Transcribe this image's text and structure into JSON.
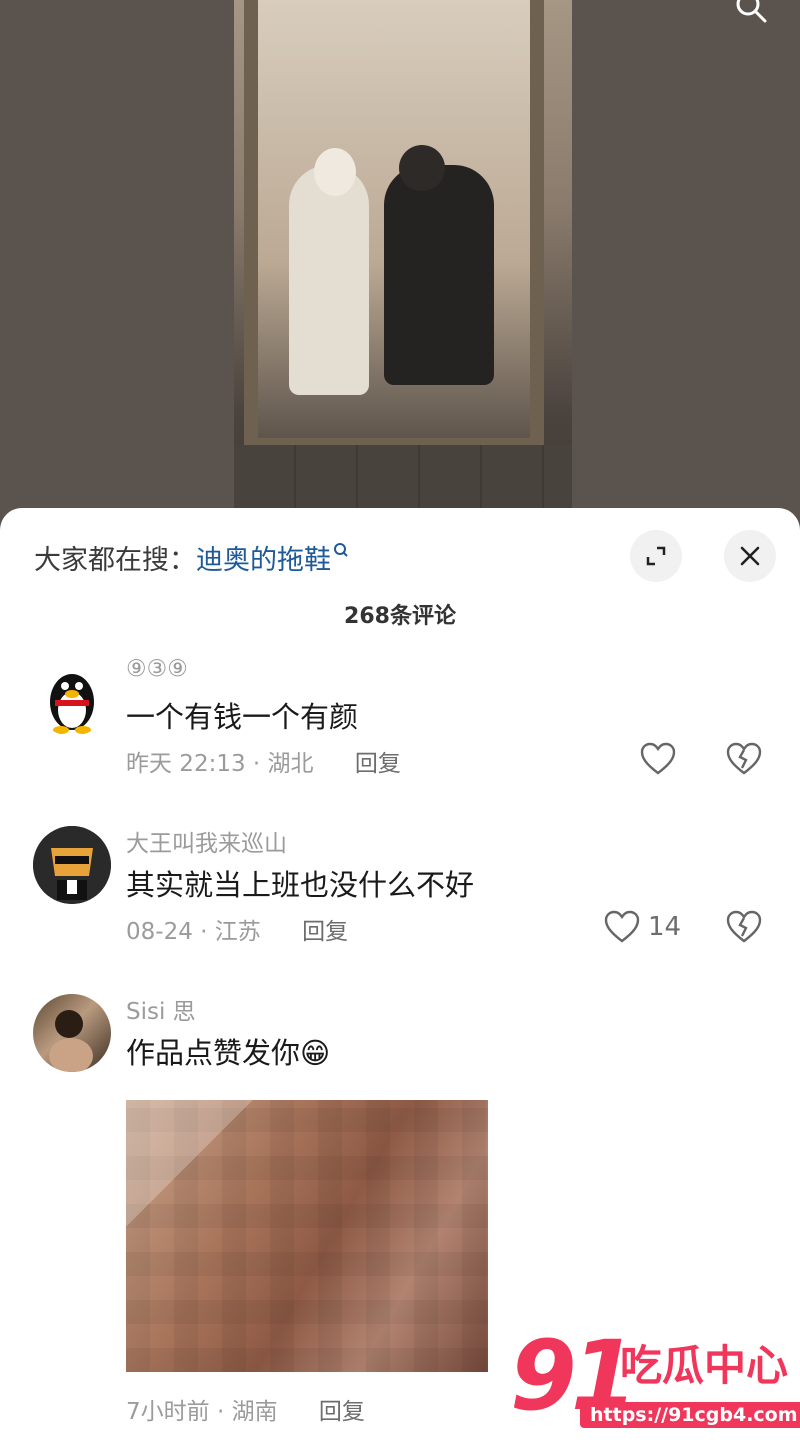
{
  "header": {
    "search_prefix": "大家都在搜：",
    "search_term": "迪奥的拖鞋"
  },
  "comments_count": "268条评论",
  "comments": [
    {
      "username": "⑨③⑨",
      "text": "一个有钱一个有颜",
      "time": "昨天 22:13",
      "location": "湖北",
      "reply": "回复",
      "likes": ""
    },
    {
      "username": "大王叫我来巡山",
      "text": "其实就当上班也没什么不好",
      "time": "08-24",
      "location": "江苏",
      "reply": "回复",
      "likes": "14"
    },
    {
      "username": "Sisi 思",
      "text": "作品点赞发你😁",
      "time": "7小时前",
      "location": "湖南",
      "reply": "回复"
    }
  ],
  "watermark": {
    "number": "91",
    "name": "吃瓜中心",
    "url": "https://91cgb4.com"
  },
  "colors": {
    "link": "#1e5a97",
    "watermark": "#f0375b"
  }
}
